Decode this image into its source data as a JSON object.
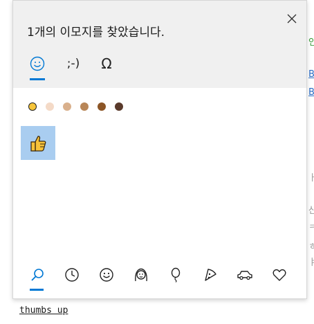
{
  "background": {
    "fragments": [
      "인",
      "B",
      "B",
      "ㅏ",
      "산",
      "ㅋ",
      "ㅎ",
      "ㅑ"
    ]
  },
  "panel": {
    "title": "1개의 이모지를 찾았습니다.",
    "close_icon": "close-icon"
  },
  "tabs": [
    {
      "name": "emoji-tab",
      "label": "☺",
      "selected": true
    },
    {
      "name": "kaomoji-tab",
      "label": ";-)",
      "selected": false
    },
    {
      "name": "symbols-tab",
      "label": "Ω",
      "selected": false
    }
  ],
  "skin_tones": [
    "#f6c53b",
    "#f4dac7",
    "#d9b08c",
    "#b88658",
    "#8c5526",
    "#5a3a2b"
  ],
  "results": [
    {
      "emoji": "👍",
      "name": "thumbs up"
    }
  ],
  "categories": [
    {
      "name": "search-icon",
      "selected": true
    },
    {
      "name": "recent-icon",
      "selected": false
    },
    {
      "name": "smiley-icon",
      "selected": false
    },
    {
      "name": "people-icon",
      "selected": false
    },
    {
      "name": "balloon-icon",
      "selected": false
    },
    {
      "name": "pizza-icon",
      "selected": false
    },
    {
      "name": "car-icon",
      "selected": false
    },
    {
      "name": "heart-icon",
      "selected": false
    }
  ],
  "caption": "thumbs up",
  "colors": {
    "accent": "#0078d4",
    "selected_cell": "#a9cdf0"
  }
}
